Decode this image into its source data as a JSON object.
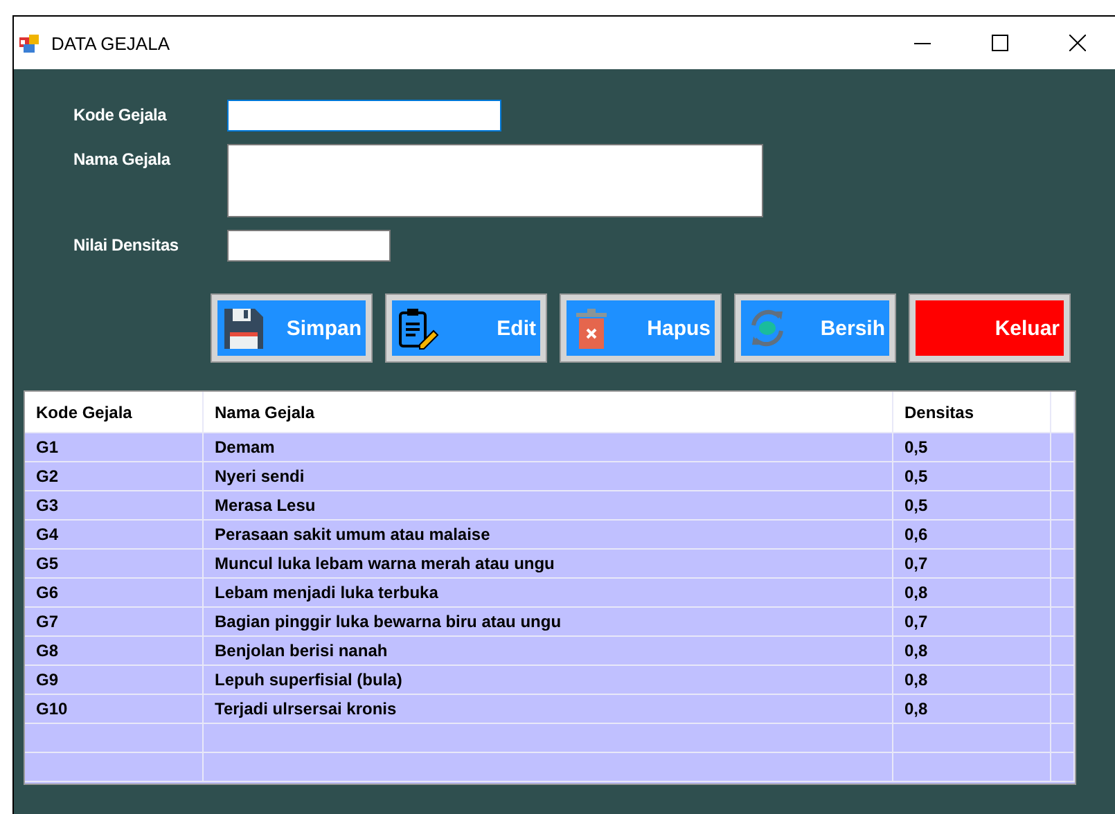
{
  "window": {
    "title": "DATA GEJALA"
  },
  "form": {
    "fields": [
      {
        "label": "Kode Gejala",
        "kind": "short",
        "focused": true
      },
      {
        "label": "Nama Gejala",
        "kind": "multiline",
        "focused": false
      },
      {
        "label": "Nilai Densitas",
        "kind": "tiny",
        "focused": false
      }
    ]
  },
  "buttons": [
    {
      "label": "Simpan",
      "kind": "save"
    },
    {
      "label": "Edit",
      "kind": "edit"
    },
    {
      "label": "Hapus",
      "kind": "delete"
    },
    {
      "label": "Bersih",
      "kind": "clear"
    },
    {
      "label": "Keluar",
      "kind": "exit"
    }
  ],
  "table": {
    "columns": [
      "Kode Gejala",
      "Nama Gejala",
      "Densitas"
    ],
    "rows": [
      [
        "G1",
        "Demam",
        "0,5"
      ],
      [
        "G2",
        "Nyeri sendi",
        "0,5"
      ],
      [
        "G3",
        "Merasa Lesu",
        "0,5"
      ],
      [
        "G4",
        "Perasaan sakit umum atau malaise",
        "0,6"
      ],
      [
        "G5",
        "Muncul luka lebam warna merah atau ungu",
        "0,7"
      ],
      [
        "G6",
        "Lebam menjadi luka terbuka",
        "0,8"
      ],
      [
        "G7",
        "Bagian pinggir luka bewarna biru atau ungu",
        "0,7"
      ],
      [
        "G8",
        "Benjolan berisi nanah",
        "0,8"
      ],
      [
        "G9",
        "Lepuh superfisial (bula)",
        "0,8"
      ],
      [
        "G10",
        "Terjadi ulrsersai kronis",
        "0,8"
      ]
    ]
  }
}
